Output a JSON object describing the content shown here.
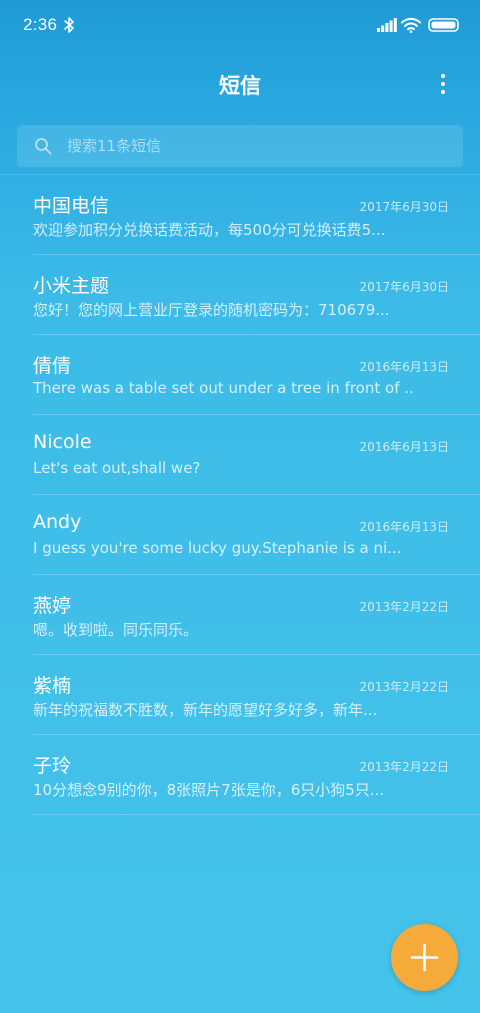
{
  "status_bar": {
    "time": "2:36",
    "icons": [
      "bluetooth-icon",
      "signal-icon",
      "wifi-icon",
      "battery-icon"
    ]
  },
  "header": {
    "title": "短信",
    "menu_icon": "more-vertical-icon"
  },
  "search": {
    "placeholder": "搜索11条短信",
    "icon": "search-icon"
  },
  "messages": [
    {
      "sender": "中国电信",
      "date": "2017年6月30日",
      "preview": "欢迎参加积分兑换话费活动，每500分可兑换话费5..."
    },
    {
      "sender": "小米主题",
      "date": "2017年6月30日",
      "preview": "您好！您的网上营业厅登录的随机密码为：710679..."
    },
    {
      "sender": "倩倩",
      "date": "2016年6月13日",
      "preview": "There was a table set out under a tree in front of ..."
    },
    {
      "sender": "Nicole",
      "date": "2016年6月13日",
      "preview": "Let's eat out,shall we?"
    },
    {
      "sender": "Andy",
      "date": "2016年6月13日",
      "preview": "I guess you're some lucky guy.Stephanie is a ni..."
    },
    {
      "sender": "燕婷",
      "date": "2013年2月22日",
      "preview": "嗯。收到啦。同乐同乐。"
    },
    {
      "sender": "紫楠",
      "date": "2013年2月22日",
      "preview": "新年的祝福数不胜数，新年的愿望好多好多，新年..."
    },
    {
      "sender": "子玲",
      "date": "2013年2月22日",
      "preview": "10分想念9别的你，8张照片7张是你，6只小狗5只..."
    }
  ],
  "fab": {
    "icon": "plus-icon"
  },
  "colors": {
    "background_top": "#1f9ad6",
    "background_bottom": "#45c3ea",
    "fab": "#f5aa3a"
  }
}
